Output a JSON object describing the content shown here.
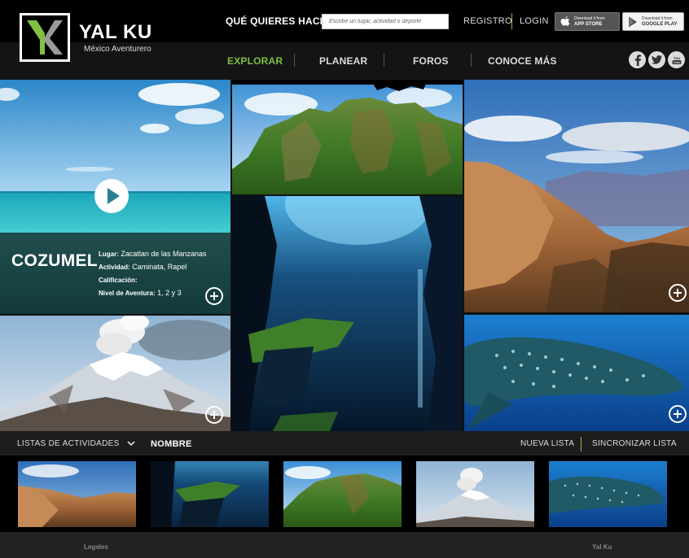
{
  "brand": {
    "name": "YAL KU",
    "tagline": "México Aventurero"
  },
  "header": {
    "question": "QUÉ QUIERES HACER?",
    "search_placeholder": "Escribe un lugar, actividad o deporte",
    "register": "REGISTRO",
    "login": "LOGIN",
    "app_store": {
      "line1": "Download it from",
      "line2": "APP STORE"
    },
    "google_play": {
      "line1": "Download it from",
      "line2": "GOOGLE PLAY"
    }
  },
  "nav": {
    "items": [
      {
        "label": "EXPLORAR",
        "active": true
      },
      {
        "label": "PLANEAR"
      },
      {
        "label": "FOROS"
      },
      {
        "label": "CONOCE MÁS"
      }
    ],
    "accent": "#7fc241"
  },
  "social": [
    "facebook-icon",
    "twitter-icon",
    "youtube-icon"
  ],
  "featured": {
    "title": "COZUMEL",
    "place_label": "Lugar:",
    "place_value": "Zacatlan de las Manzanas",
    "activity_label": "Actividad:",
    "activity_value": "Caminata, Rapel",
    "rating_label": "Calificación:",
    "level_label": "Nivel de Aventura:",
    "level_value": "1, 2 y 3"
  },
  "lists_bar": {
    "lists_label": "LISTAS DE ACTIVIDADES",
    "name_label": "NOMBRE",
    "new_list": "NUEVA LISTA",
    "sync_list": "SINCRONIZAR LISTA"
  },
  "footer": {
    "legal": "Legales",
    "brand": "Yal Ku"
  }
}
